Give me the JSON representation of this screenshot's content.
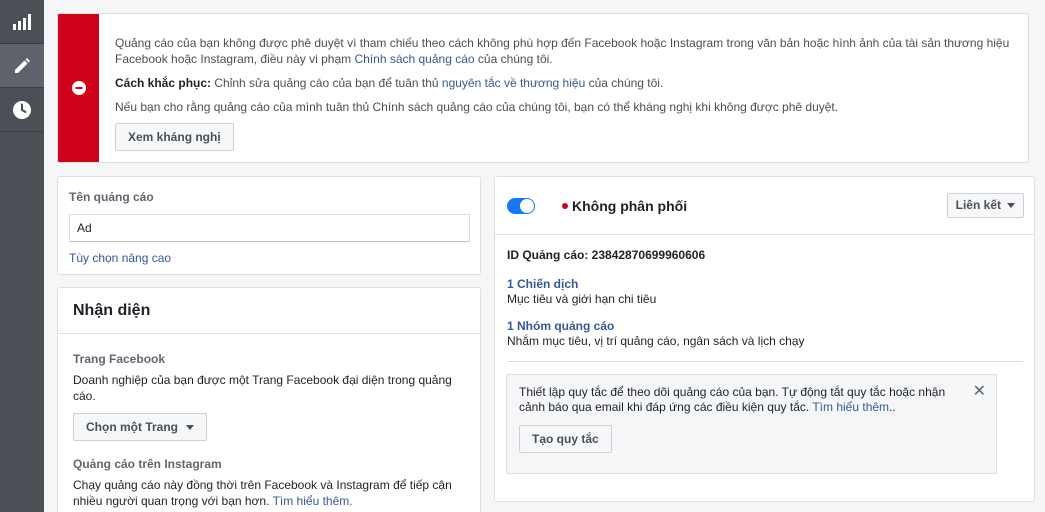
{
  "sidebar": {
    "items": [
      {
        "icon": "bar-chart-icon"
      },
      {
        "icon": "pencil-icon",
        "active": true
      },
      {
        "icon": "clock-icon"
      }
    ]
  },
  "alert": {
    "line1_text": "Quảng cáo của bạn không được phê duyệt vì tham chiếu theo cách không phù hợp đến Facebook hoặc Instagram trong văn bản hoặc hình ảnh của tài sản thương hiệu Facebook hoặc Instagram, điều này vi phạm ",
    "line1_link": "Chính sách quảng cáo",
    "line1_end": " của chúng tôi.",
    "fix_label": "Cách khắc phục:",
    "fix_text": " Chỉnh sửa quảng cáo của bạn để tuân thủ ",
    "fix_link": "nguyên tắc về thương hiệu",
    "fix_end": " của chúng tôi.",
    "appeal_text": "Nếu bạn cho rằng quảng cáo của mình tuân thủ Chính sách quảng cáo của chúng tôi, bạn có thể kháng nghị khi không được phê duyệt.",
    "appeal_button": "Xem kháng nghị",
    "color": "#d0021b"
  },
  "ad_name": {
    "label": "Tên quảng cáo",
    "value": "Ad",
    "advanced_link": "Tùy chọn nâng cao"
  },
  "identity": {
    "title": "Nhận diện",
    "facebook_page_label": "Trang Facebook",
    "facebook_page_desc": "Doanh nghiệp của bạn được một Trang Facebook đại diện trong quảng cáo.",
    "choose_page_button": "Chọn một Trang",
    "instagram_label": "Quảng cáo trên Instagram",
    "instagram_desc": "Chạy quảng cáo này đồng thời trên Facebook và Instagram để tiếp cận nhiều người quan trọng với bạn hơn. ",
    "instagram_link": "Tìm hiểu thêm."
  },
  "status": {
    "toggle_on": true,
    "status_text": "Không phân phối",
    "links_button": "Liên kết",
    "ad_id": "ID Quảng cáo: 23842870699960606",
    "campaign_link": "1 Chiến dịch",
    "campaign_desc": "Mục tiêu và giới hạn chi tiêu",
    "adset_link": "1 Nhóm quảng cáo",
    "adset_desc": "Nhắm mục tiêu, vị trí quảng cáo, ngân sách và lịch chạy",
    "rule_text": "Thiết lập quy tắc để theo dõi quảng cáo của bạn. Tự động tắt quy tắc hoặc nhận cảnh báo qua email khi đáp ứng các điều kiện quy tắc. ",
    "rule_link": "Tìm hiểu thêm",
    "rule_link_end": "..",
    "create_rule_button": "Tạo quy tắc",
    "accent": "#1877f2"
  }
}
